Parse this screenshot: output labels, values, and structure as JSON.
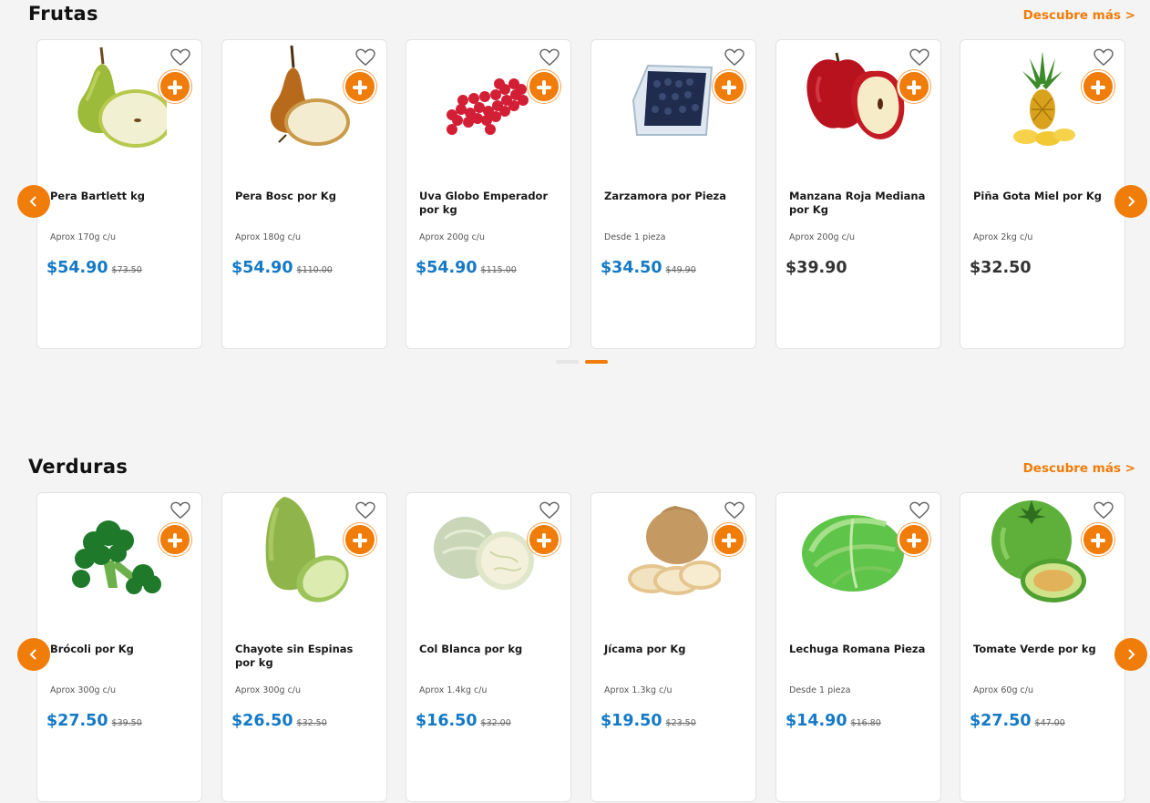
{
  "colors": {
    "accent": "#f07c0a",
    "price_blue": "#1479c6",
    "price_plain": "#333333"
  },
  "icons": {
    "favorite": "heart-outline-icon",
    "add": "plus-circle-icon",
    "prev": "chevron-left-icon",
    "next": "chevron-right-icon"
  },
  "carousel": {
    "active_page": 2,
    "total_pages": 2
  },
  "frutas": {
    "title": "Frutas",
    "link": "Descubre más >",
    "products": [
      {
        "name": "Pera Bartlett kg",
        "desc": "Aprox 170g c/u",
        "price": "$54.90",
        "old_price": "$73.50"
      },
      {
        "name": "Pera Bosc por Kg",
        "desc": "Aprox 180g c/u",
        "price": "$54.90",
        "old_price": "$110.00"
      },
      {
        "name": "Uva Globo Emperador por kg",
        "desc": "Aprox 200g c/u",
        "price": "$54.90",
        "old_price": "$115.00"
      },
      {
        "name": "Zarzamora por Pieza",
        "desc": "Desde 1 pieza",
        "price": "$34.50",
        "old_price": "$49.90"
      },
      {
        "name": "Manzana Roja Mediana por Kg",
        "desc": "Aprox 200g c/u",
        "price": "$39.90",
        "old_price": ""
      },
      {
        "name": "Piña Gota Miel por Kg",
        "desc": "Aprox 2kg c/u",
        "price": "$32.50",
        "old_price": ""
      }
    ]
  },
  "verduras": {
    "title": "Verduras",
    "link": "Descubre más >",
    "products": [
      {
        "name": "Brócoli por Kg",
        "desc": "Aprox 300g c/u",
        "price": "$27.50",
        "old_price": "$39.50"
      },
      {
        "name": "Chayote sin Espinas por kg",
        "desc": "Aprox 300g c/u",
        "price": "$26.50",
        "old_price": "$32.50"
      },
      {
        "name": "Col Blanca por kg",
        "desc": "Aprox 1.4kg c/u",
        "price": "$16.50",
        "old_price": "$32.00"
      },
      {
        "name": "Jícama por Kg",
        "desc": "Aprox 1.3kg c/u",
        "price": "$19.50",
        "old_price": "$23.50"
      },
      {
        "name": "Lechuga Romana Pieza",
        "desc": "Desde 1 pieza",
        "price": "$14.90",
        "old_price": "$16.80"
      },
      {
        "name": "Tomate Verde por kg",
        "desc": "Aprox 60g c/u",
        "price": "$27.50",
        "old_price": "$47.00"
      }
    ]
  }
}
